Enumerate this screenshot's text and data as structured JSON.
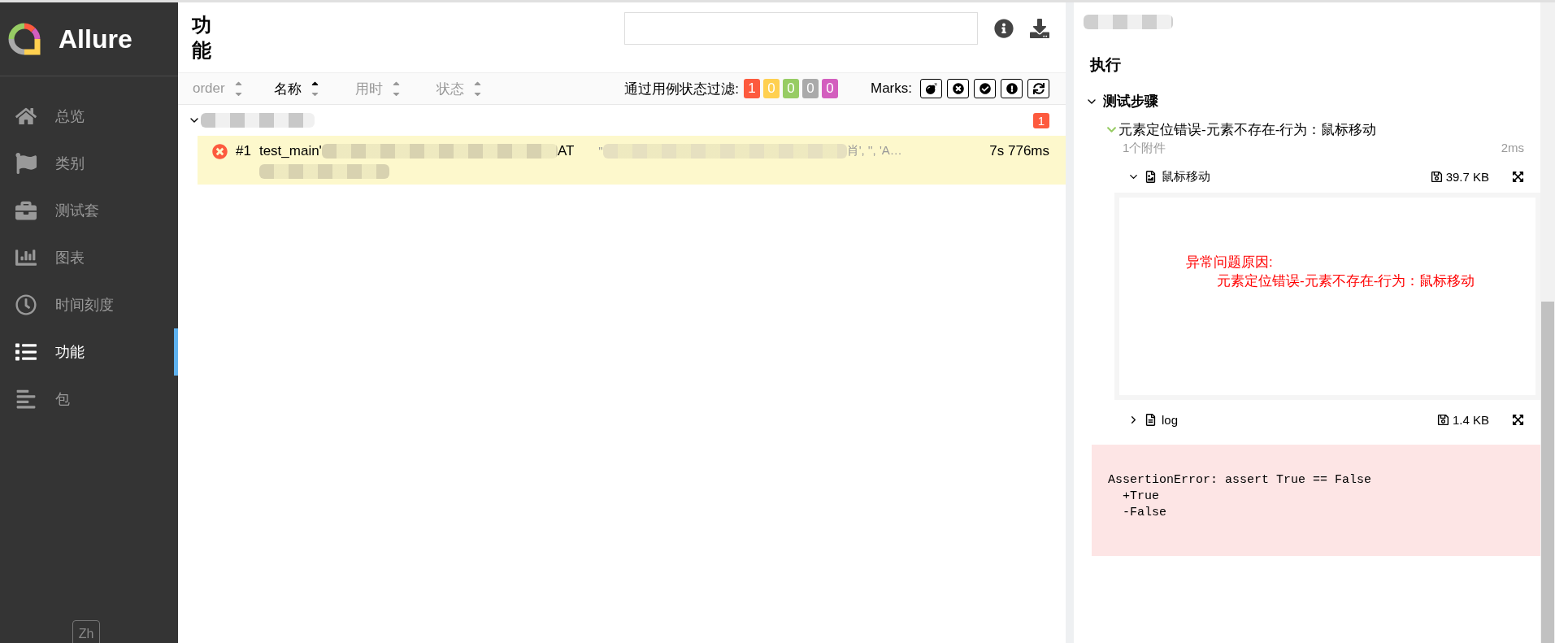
{
  "sidebar": {
    "brand": "Allure",
    "language": "Zh",
    "items": [
      {
        "label": "总览",
        "kind": "home",
        "selected": false
      },
      {
        "label": "类别",
        "kind": "flag",
        "selected": false
      },
      {
        "label": "测试套",
        "kind": "briefcase",
        "selected": false
      },
      {
        "label": "图表",
        "kind": "chart",
        "selected": false
      },
      {
        "label": "时间刻度",
        "kind": "clock",
        "selected": false
      },
      {
        "label": "功能",
        "kind": "list",
        "selected": true
      },
      {
        "label": "包",
        "kind": "align",
        "selected": false
      }
    ]
  },
  "main": {
    "title": "功能",
    "sort_columns": [
      {
        "label": "order",
        "selected": false
      },
      {
        "label": "名称",
        "selected": true
      },
      {
        "label": "用时",
        "selected": false
      },
      {
        "label": "状态",
        "selected": false
      }
    ],
    "status_filter": {
      "label": "通过用例状态过滤:",
      "counts": [
        {
          "value": "1",
          "color": "#fd5a3e"
        },
        {
          "value": "0",
          "color": "#ffd050"
        },
        {
          "value": "0",
          "color": "#97cc64"
        },
        {
          "value": "0",
          "color": "#aaaaaa"
        },
        {
          "value": "0",
          "color": "#d35ebe"
        }
      ]
    },
    "marks": {
      "label": "Marks:",
      "buttons": [
        {
          "kind": "bomb"
        },
        {
          "kind": "failed"
        },
        {
          "kind": "passed"
        },
        {
          "kind": "broken"
        },
        {
          "kind": "retry"
        }
      ]
    },
    "groups": [
      {
        "expanded": true,
        "count": "1",
        "tests": [
          {
            "passed": false,
            "number": "#1",
            "name_start": "test_main'",
            "name_end": "AT",
            "params_start": "\"",
            "params_end": "肖', '', 'A…",
            "duration": "7s 776ms"
          }
        ]
      }
    ]
  },
  "details": {
    "section_title": "执行",
    "steps_section": {
      "title": "测试步骤",
      "expanded": true,
      "steps": [
        {
          "title": "元素定位错误-元素不存在-行为：鼠标移动",
          "passed": true,
          "attachments_count": "1个附件",
          "duration": "2ms",
          "attachments": [
            {
              "kind": "image",
              "name": "鼠标移动",
              "size": "39.7 KB",
              "expanded": true,
              "preview_lines": [
                "异常问题原因:",
                "元素定位错误-元素不存在-行为：鼠标移动"
              ]
            },
            {
              "kind": "text",
              "name": "log",
              "size": "1.4 KB",
              "expanded": false
            }
          ]
        }
      ]
    },
    "error": {
      "message": "AssertionError: assert True == False\n  +True\n  -False"
    }
  }
}
